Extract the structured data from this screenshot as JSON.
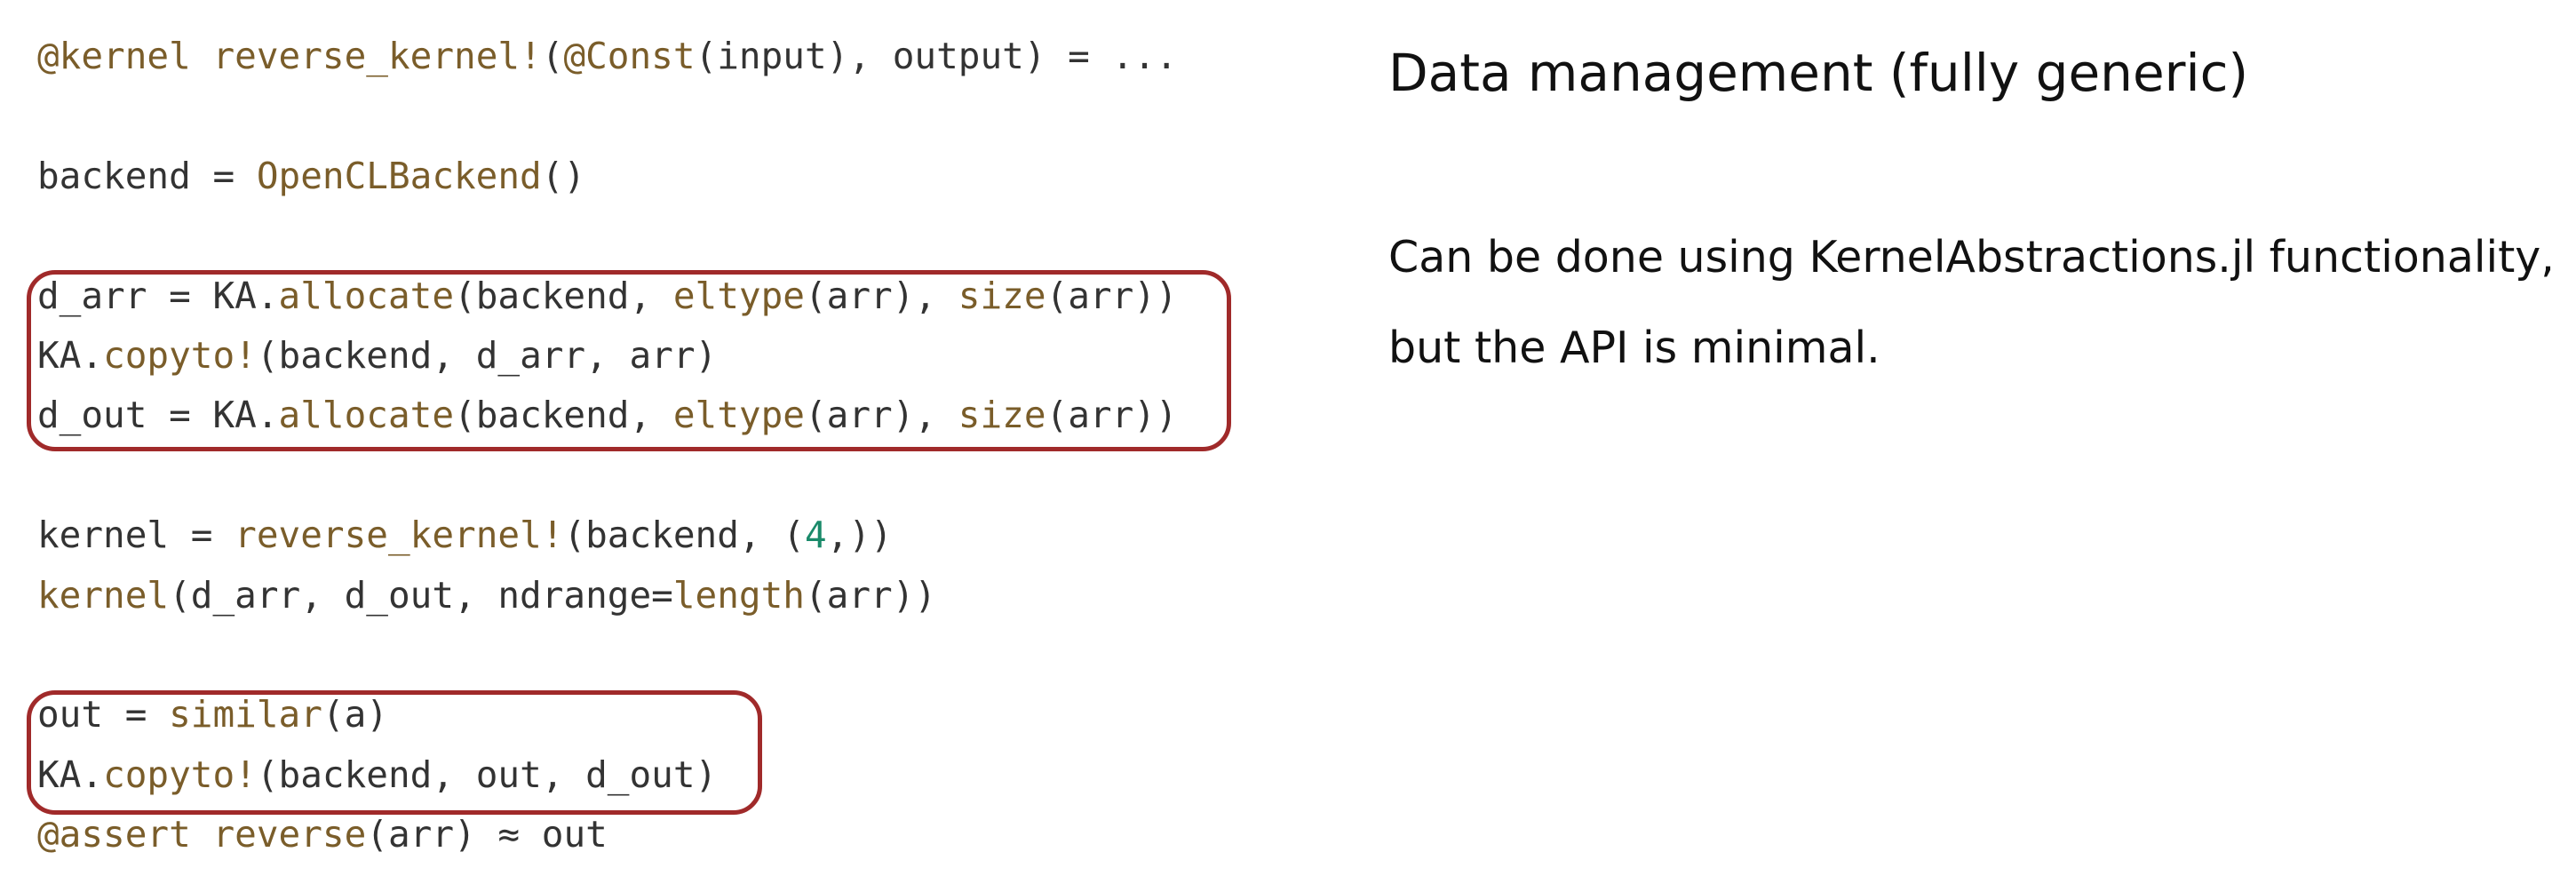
{
  "code_lines": [
    [
      {
        "t": "@kernel",
        "c": "mac"
      },
      {
        "t": " ",
        "c": "txt"
      },
      {
        "t": "reverse_kernel!",
        "c": "fn"
      },
      {
        "t": "(",
        "c": "txt"
      },
      {
        "t": "@Const",
        "c": "mac"
      },
      {
        "t": "(input), output) = ...",
        "c": "txt"
      }
    ],
    [],
    [
      {
        "t": "backend = ",
        "c": "txt"
      },
      {
        "t": "OpenCLBackend",
        "c": "fn"
      },
      {
        "t": "()",
        "c": "txt"
      }
    ],
    [],
    [
      {
        "t": "d_arr = KA.",
        "c": "txt"
      },
      {
        "t": "allocate",
        "c": "fn"
      },
      {
        "t": "(backend, ",
        "c": "txt"
      },
      {
        "t": "eltype",
        "c": "fn"
      },
      {
        "t": "(arr), ",
        "c": "txt"
      },
      {
        "t": "size",
        "c": "fn"
      },
      {
        "t": "(arr))",
        "c": "txt"
      }
    ],
    [
      {
        "t": "KA.",
        "c": "txt"
      },
      {
        "t": "copyto!",
        "c": "fn"
      },
      {
        "t": "(backend, d_arr, arr)",
        "c": "txt"
      }
    ],
    [
      {
        "t": "d_out = KA.",
        "c": "txt"
      },
      {
        "t": "allocate",
        "c": "fn"
      },
      {
        "t": "(backend, ",
        "c": "txt"
      },
      {
        "t": "eltype",
        "c": "fn"
      },
      {
        "t": "(arr), ",
        "c": "txt"
      },
      {
        "t": "size",
        "c": "fn"
      },
      {
        "t": "(arr))",
        "c": "txt"
      }
    ],
    [],
    [
      {
        "t": "kernel = ",
        "c": "txt"
      },
      {
        "t": "reverse_kernel!",
        "c": "fn"
      },
      {
        "t": "(backend, (",
        "c": "txt"
      },
      {
        "t": "4",
        "c": "num"
      },
      {
        "t": ",))",
        "c": "txt"
      }
    ],
    [
      {
        "t": "kernel",
        "c": "fn"
      },
      {
        "t": "(d_arr, d_out, ndrange=",
        "c": "txt"
      },
      {
        "t": "length",
        "c": "fn"
      },
      {
        "t": "(arr))",
        "c": "txt"
      }
    ],
    [],
    [
      {
        "t": "out = ",
        "c": "txt"
      },
      {
        "t": "similar",
        "c": "fn"
      },
      {
        "t": "(a)",
        "c": "txt"
      }
    ],
    [
      {
        "t": "KA.",
        "c": "txt"
      },
      {
        "t": "copyto!",
        "c": "fn"
      },
      {
        "t": "(backend, out, d_out)",
        "c": "txt"
      }
    ],
    [
      {
        "t": "@assert",
        "c": "mac"
      },
      {
        "t": " ",
        "c": "txt"
      },
      {
        "t": "reverse",
        "c": "fn"
      },
      {
        "t": "(arr) ≈ out",
        "c": "txt"
      }
    ]
  ],
  "side": {
    "title": "Data management (fully generic)",
    "body_line1": "Can be done using KernelAbstractions.jl functionality,",
    "body_line2": "but the API is minimal."
  },
  "colors": {
    "highlight_border": "#a02a2a",
    "function_name": "#7a5d2a",
    "number_literal": "#1a8a6a",
    "plain_code": "#333333"
  }
}
